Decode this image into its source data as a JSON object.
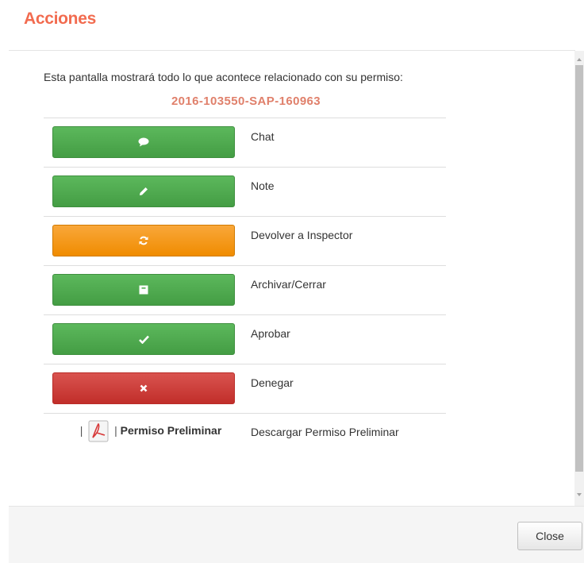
{
  "modal": {
    "title": "Acciones",
    "intro_text": "Esta pantalla mostrará todo lo que acontece relacionado con su permiso:",
    "permit_number": "2016-103550-SAP-160963"
  },
  "actions": [
    {
      "label": "Chat",
      "color": "green",
      "icon": "comment-icon"
    },
    {
      "label": "Note",
      "color": "green",
      "icon": "pencil-icon"
    },
    {
      "label": "Devolver a Inspector",
      "color": "orange",
      "icon": "refresh-icon"
    },
    {
      "label": "Archivar/Cerrar",
      "color": "green",
      "icon": "archive-icon"
    },
    {
      "label": "Aprobar",
      "color": "green",
      "icon": "check-icon"
    },
    {
      "label": "Denegar",
      "color": "red",
      "icon": "times-icon"
    }
  ],
  "download": {
    "separator": "|",
    "link_text": "Permiso Preliminar",
    "label": "Descargar Permiso Preliminar",
    "icon": "pdf-icon"
  },
  "footer": {
    "close_label": "Close"
  },
  "colors": {
    "title": "#f26b4f",
    "permit_number": "#e0806b",
    "green": "#5cb85c",
    "orange": "#f0ad4e",
    "red": "#d9534f"
  }
}
